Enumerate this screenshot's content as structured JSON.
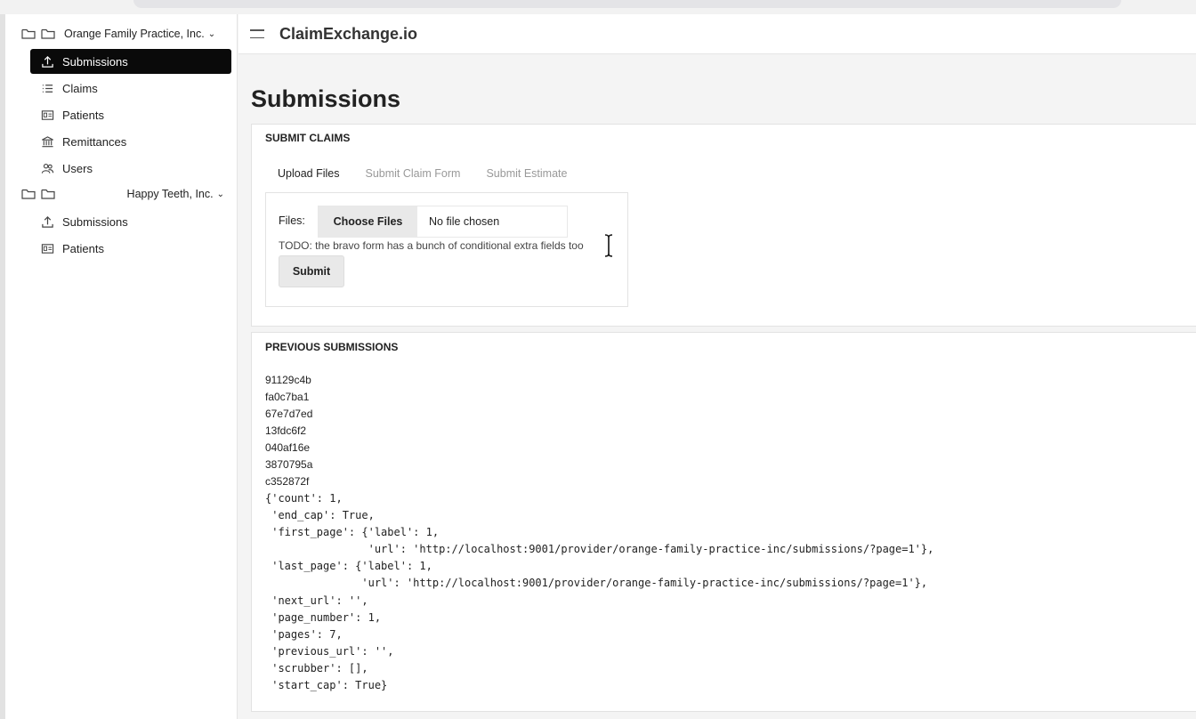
{
  "app": {
    "brand": "ClaimExchange.io"
  },
  "sidebar": {
    "orgs": [
      {
        "name": "Orange Family Practice, Inc.",
        "chevron": "⌄",
        "items": [
          {
            "label": "Submissions",
            "icon": "upload-icon",
            "active": true
          },
          {
            "label": "Claims",
            "icon": "list-icon"
          },
          {
            "label": "Patients",
            "icon": "id-card-icon"
          },
          {
            "label": "Remittances",
            "icon": "bank-icon"
          },
          {
            "label": "Users",
            "icon": "users-icon"
          }
        ]
      },
      {
        "name": "Happy Teeth, Inc.",
        "chevron": "⌄",
        "items": [
          {
            "label": "Submissions",
            "icon": "upload-icon"
          },
          {
            "label": "Patients",
            "icon": "id-card-icon"
          }
        ]
      }
    ]
  },
  "page": {
    "title": "Submissions"
  },
  "submit_claims": {
    "title": "SUBMIT CLAIMS",
    "tabs": [
      {
        "label": "Upload Files",
        "active": true
      },
      {
        "label": "Submit Claim Form"
      },
      {
        "label": "Submit Estimate"
      }
    ],
    "files_label": "Files:",
    "choose_label": "Choose Files",
    "no_file_label": "No file chosen",
    "todo": "TODO: the bravo form has a bunch of conditional extra fields too",
    "submit_label": "Submit"
  },
  "previous": {
    "title": "PREVIOUS SUBMISSIONS",
    "ids": [
      "91129c4b",
      "fa0c7ba1",
      "67e7d7ed",
      "13fdc6f2",
      "040af16e",
      "3870795a",
      "c352872f"
    ],
    "pagination_dump": "{'count': 1,\n 'end_cap': True,\n 'first_page': {'label': 1,\n                'url': 'http://localhost:9001/provider/orange-family-practice-inc/submissions/?page=1'},\n 'last_page': {'label': 1,\n               'url': 'http://localhost:9001/provider/orange-family-practice-inc/submissions/?page=1'},\n 'next_url': '',\n 'page_number': 1,\n 'pages': 7,\n 'previous_url': '',\n 'scrubber': [],\n 'start_cap': True}"
  },
  "colors": {
    "active_nav_bg": "#0a0a0a",
    "button_bg": "#e9e9e9",
    "inactive_tab": "#999999"
  }
}
